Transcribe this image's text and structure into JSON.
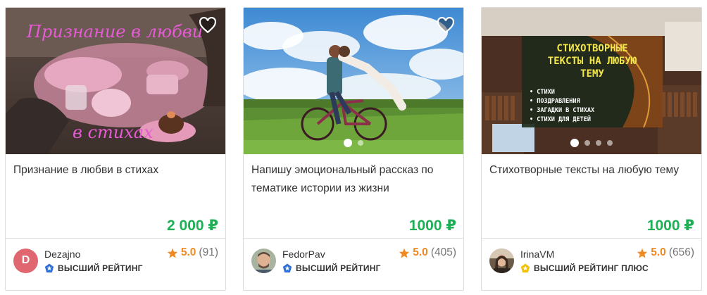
{
  "cards": [
    {
      "image_overlay": {
        "top": "Признание в любви",
        "bottom": "в стихах"
      },
      "dots": 0,
      "title": "Признание в любви в стихах",
      "price": "2 000 ₽",
      "seller": {
        "avatar_letter": "D",
        "name": "Dezajno",
        "badge": "ВЫСШИЙ РЕЙТИНГ",
        "badge_color": "#2f6fd8"
      },
      "rating": {
        "score": "5.0",
        "count": "(91)"
      }
    },
    {
      "dots": 2,
      "title": "Напишу эмоциональный рассказ по тематике истории из жизни",
      "price": "1000 ₽",
      "seller": {
        "name": "FedorPav",
        "badge": "ВЫСШИЙ РЕЙТИНГ",
        "badge_color": "#2f6fd8"
      },
      "rating": {
        "score": "5.0",
        "count": "(405)"
      }
    },
    {
      "image_overlay": {
        "heading": [
          "СТИХОТВОРНЫЕ",
          "ТЕКСТЫ НА ЛЮБУЮ",
          "ТЕМУ"
        ],
        "bullets": [
          "• СТИХИ",
          "• ПОЗДРАВЛЕНИЯ",
          "• ЗАГАДКИ В СТИХАХ",
          "• СТИХИ ДЛЯ ДЕТЕЙ"
        ]
      },
      "dots": 4,
      "title": "Стихотворные тексты на любую тему",
      "price": "1000 ₽",
      "seller": {
        "name": "IrinaVM",
        "badge": "ВЫСШИЙ РЕЙТИНГ ПЛЮС",
        "badge_color": "#f2c200"
      },
      "rating": {
        "score": "5.0",
        "count": "(656)"
      }
    }
  ],
  "colors": {
    "price": "#1eb055",
    "rating": "#f08a24",
    "heart": "#ffffff"
  },
  "icons": [
    "heart-icon",
    "star-icon",
    "badge-icon"
  ]
}
